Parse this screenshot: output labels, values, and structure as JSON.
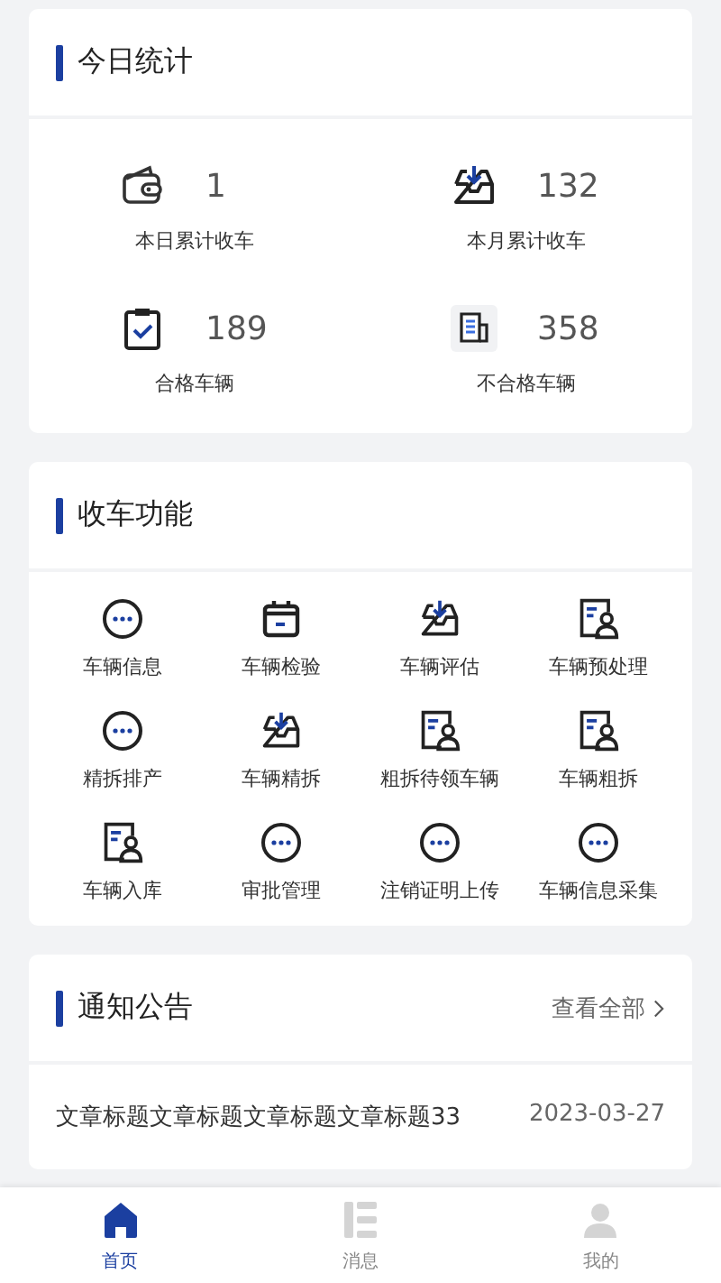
{
  "stats": {
    "title": "今日统计",
    "items": [
      {
        "kind": "wallet",
        "value": "1",
        "label": "本日累计收车"
      },
      {
        "kind": "inbox",
        "value": "132",
        "label": "本月累计收车"
      },
      {
        "kind": "clipboard",
        "value": "189",
        "label": "合格车辆"
      },
      {
        "kind": "document",
        "value": "358",
        "label": "不合格车辆"
      }
    ]
  },
  "functions": {
    "title": "收车功能",
    "items": [
      {
        "kind": "dots",
        "label": "车辆信息"
      },
      {
        "kind": "calendar",
        "label": "车辆检验"
      },
      {
        "kind": "inbox",
        "label": "车辆评估"
      },
      {
        "kind": "profile",
        "label": "车辆预处理"
      },
      {
        "kind": "dots",
        "label": "精拆排产"
      },
      {
        "kind": "inbox",
        "label": "车辆精拆"
      },
      {
        "kind": "profile",
        "label": "粗拆待领车辆"
      },
      {
        "kind": "profile",
        "label": "车辆粗拆"
      },
      {
        "kind": "profile",
        "label": "车辆入库"
      },
      {
        "kind": "dots",
        "label": "审批管理"
      },
      {
        "kind": "dots",
        "label": "注销证明上传"
      },
      {
        "kind": "dots",
        "label": "车辆信息采集"
      }
    ]
  },
  "notices": {
    "title": "通知公告",
    "more": "查看全部",
    "items": [
      {
        "title": "文章标题文章标题文章标题文章标题33",
        "date": "2023-03-27"
      }
    ]
  },
  "tabbar": [
    {
      "kind": "home",
      "label": "首页",
      "selected": true
    },
    {
      "kind": "list",
      "label": "消息",
      "selected": false
    },
    {
      "kind": "person",
      "label": "我的",
      "selected": false
    }
  ]
}
